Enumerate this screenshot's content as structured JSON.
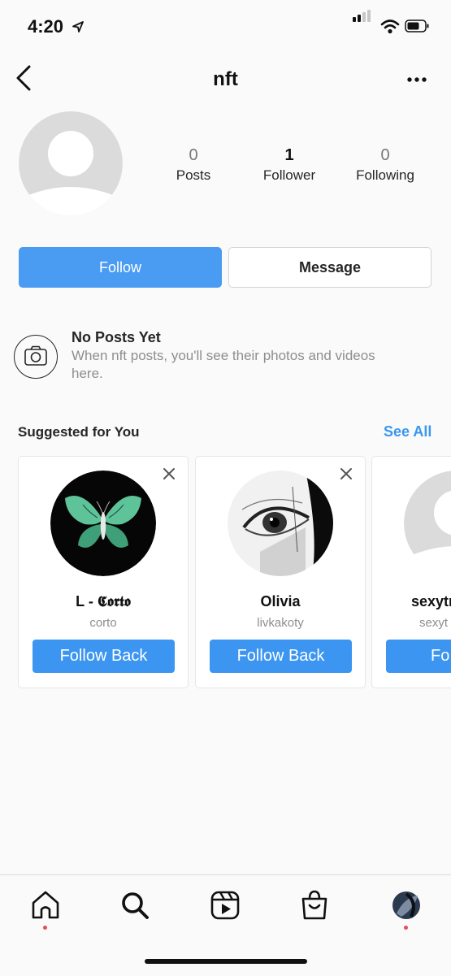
{
  "status_bar": {
    "time": "4:20"
  },
  "header": {
    "username": "nft"
  },
  "profile": {
    "stats": [
      {
        "value": "0",
        "label": "Posts"
      },
      {
        "value": "1",
        "label": "Follower"
      },
      {
        "value": "0",
        "label": "Following"
      }
    ]
  },
  "actions": {
    "follow_label": "Follow",
    "message_label": "Message"
  },
  "no_posts": {
    "title": "No Posts Yet",
    "description": "When nft posts, you'll see their photos and videos here."
  },
  "suggested": {
    "title": "Suggested for You",
    "see_all": "See All",
    "cards": [
      {
        "name": "L - 𝕮𝖔𝖗𝖙𝖔",
        "handle": "corto",
        "button": "Follow Back"
      },
      {
        "name": "Olivia",
        "handle": "livkakoty",
        "button": "Follow Back"
      },
      {
        "name": "sexytr",
        "handle": "sexyt",
        "button": "Fo"
      }
    ]
  },
  "tab_bar": {
    "items": [
      "home-icon",
      "search-icon",
      "reels-icon",
      "shop-icon",
      "profile-avatar"
    ]
  },
  "colors": {
    "primary_blue": "#4a9bf2",
    "link_blue": "#3897f0",
    "notification_dot": "#ed4956"
  }
}
